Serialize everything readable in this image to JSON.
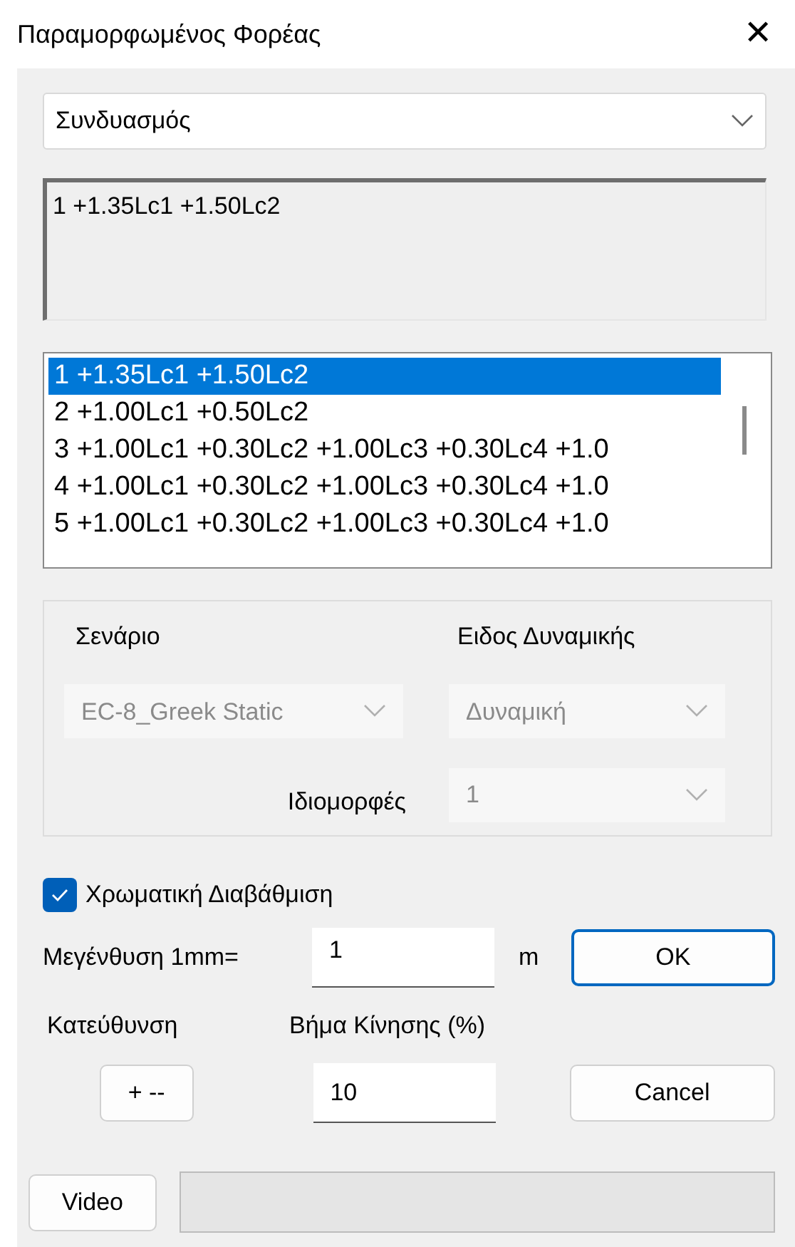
{
  "window": {
    "title": "Παραμορφωμένος Φορέας",
    "close": "✕"
  },
  "combination_select": {
    "value": "Συνδυασμός"
  },
  "combination_text": {
    "value": "1 +1.35Lc1 +1.50Lc2"
  },
  "combination_list": [
    {
      "label": "1 +1.35Lc1 +1.50Lc2",
      "selected": true
    },
    {
      "label": "2 +1.00Lc1 +0.50Lc2",
      "selected": false
    },
    {
      "label": "3 +1.00Lc1 +0.30Lc2 +1.00Lc3 +0.30Lc4 +1.0",
      "selected": false
    },
    {
      "label": "4 +1.00Lc1 +0.30Lc2 +1.00Lc3 +0.30Lc4 +1.0",
      "selected": false
    },
    {
      "label": "5 +1.00Lc1 +0.30Lc2 +1.00Lc3 +0.30Lc4 +1.0",
      "selected": false
    }
  ],
  "group": {
    "scenario_label": "Σενάριο",
    "scenario": {
      "value": "EC-8_Greek Static",
      "disabled": true
    },
    "dynamic_label": "Ειδος Δυναμικής",
    "dynamic": {
      "value": "Δυναμική",
      "disabled": true
    },
    "modes_label": "Ιδιομορφές",
    "modes": {
      "value": "1",
      "disabled": true
    }
  },
  "color_grading": {
    "label": "Χρωματική Διαβάθμιση",
    "checked": true
  },
  "magnification": {
    "label": "Μεγένθυση 1mm=",
    "value": "1",
    "unit": "m"
  },
  "ok_button": "OK",
  "direction": {
    "label": "Κατεύθυνση",
    "button": "+ --"
  },
  "step": {
    "label": "Βήμα Κίνησης (%)",
    "value": "10"
  },
  "cancel_button": "Cancel",
  "video_button": "Video",
  "progress": {
    "level": 0
  }
}
